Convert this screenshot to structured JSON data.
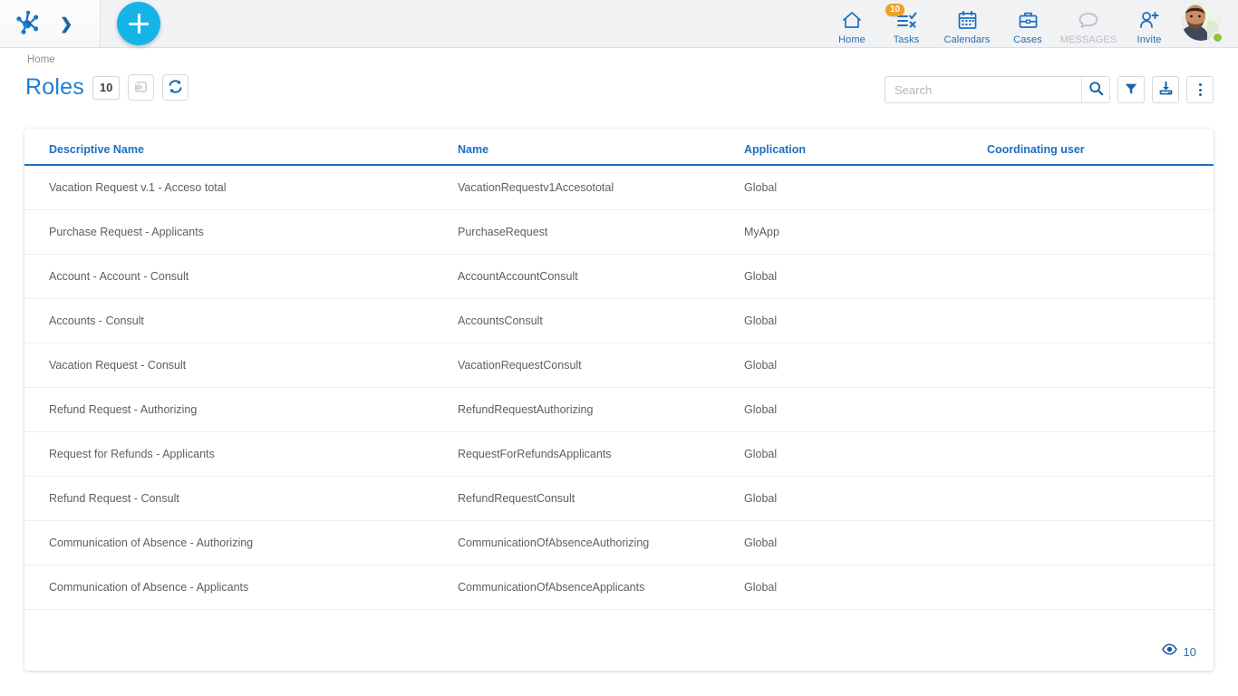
{
  "topbar": {
    "logo_icon": "network-node-logo",
    "expand_caret_icon": "chevron-right-icon",
    "add_button_label": "+",
    "nav": [
      {
        "label": "Home",
        "icon": "home-icon",
        "badge": null,
        "disabled": false
      },
      {
        "label": "Tasks",
        "icon": "checklist-icon",
        "badge": "10",
        "disabled": false
      },
      {
        "label": "Calendars",
        "icon": "calendar-icon",
        "badge": null,
        "disabled": false
      },
      {
        "label": "Cases",
        "icon": "briefcase-icon",
        "badge": null,
        "disabled": false
      },
      {
        "label": "MESSAGES",
        "icon": "chat-bubble-icon",
        "badge": null,
        "disabled": true
      },
      {
        "label": "Invite",
        "icon": "person-plus-icon",
        "badge": null,
        "disabled": false
      }
    ],
    "avatar": "user-avatar",
    "presence_status": "online"
  },
  "header": {
    "breadcrumb": "Home",
    "title": "Roles",
    "count": "10",
    "undo_icon": "undo-arrow-icon",
    "refresh_icon": "refresh-icon"
  },
  "search": {
    "value": "",
    "placeholder": "Search",
    "search_icon": "magnifier-icon",
    "filter_icon": "funnel-filter-icon",
    "export_icon": "download-export-icon",
    "more_icon": "kebab-menu-icon"
  },
  "table": {
    "columns": [
      "Descriptive Name",
      "Name",
      "Application",
      "Coordinating user"
    ],
    "rows": [
      {
        "descriptive_name": "Vacation Request v.1 - Acceso total",
        "name": "VacationRequestv1Accesototal",
        "application": "Global",
        "coordinating_user": ""
      },
      {
        "descriptive_name": "Purchase Request - Applicants",
        "name": "PurchaseRequest",
        "application": "MyApp",
        "coordinating_user": ""
      },
      {
        "descriptive_name": "Account - Account - Consult",
        "name": "AccountAccountConsult",
        "application": "Global",
        "coordinating_user": ""
      },
      {
        "descriptive_name": "Accounts - Consult",
        "name": "AccountsConsult",
        "application": "Global",
        "coordinating_user": ""
      },
      {
        "descriptive_name": "Vacation Request - Consult",
        "name": "VacationRequestConsult",
        "application": "Global",
        "coordinating_user": ""
      },
      {
        "descriptive_name": "Refund Request - Authorizing",
        "name": "RefundRequestAuthorizing",
        "application": "Global",
        "coordinating_user": ""
      },
      {
        "descriptive_name": "Request for Refunds - Applicants",
        "name": "RequestForRefundsApplicants",
        "application": "Global",
        "coordinating_user": ""
      },
      {
        "descriptive_name": "Refund Request - Consult",
        "name": "RefundRequestConsult",
        "application": "Global",
        "coordinating_user": ""
      },
      {
        "descriptive_name": "Communication of Absence - Authorizing",
        "name": "CommunicationOfAbsenceAuthorizing",
        "application": "Global",
        "coordinating_user": ""
      },
      {
        "descriptive_name": "Communication of Absence - Applicants",
        "name": "CommunicationOfAbsenceApplicants",
        "application": "Global",
        "coordinating_user": ""
      }
    ]
  },
  "footer": {
    "visible_icon": "eye-icon",
    "visible_count": "10"
  },
  "colors": {
    "accent_blue": "#1d7fd4",
    "link_blue": "#2a6fb5",
    "header_blue": "#1d6fc0",
    "cyan_add": "#14b4e9",
    "badge_orange": "#f0a01e",
    "presence_green": "#8bc43f",
    "topbar_bg": "#f1f2f3",
    "text_gray": "#5a6069"
  }
}
